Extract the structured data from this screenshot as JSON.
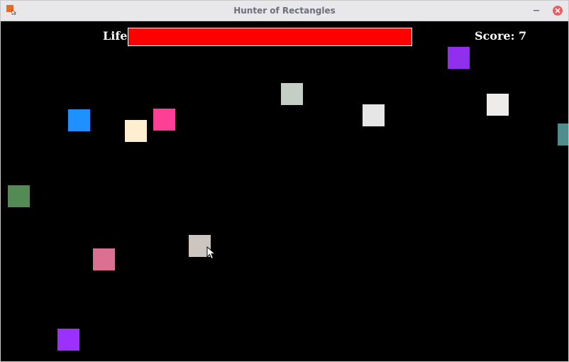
{
  "window": {
    "title": "Hunter of Rectangles",
    "app_icon": "app-icon",
    "minimize_icon": "minimize-icon",
    "close_icon": "close-icon",
    "close_color": "#f05a5a"
  },
  "hud": {
    "life_label": "Life",
    "life_level": 1.0,
    "life_color": "#ff0000",
    "score_text": "Score: 7"
  },
  "targets": [
    {
      "color": "#9030ee"
    },
    {
      "color": "#c5cec4"
    },
    {
      "color": "#e6e6e6"
    },
    {
      "color": "#eeeceb"
    },
    {
      "color": "#1e90ff"
    },
    {
      "color": "#ff3e96"
    },
    {
      "color": "#ffeecf"
    },
    {
      "color": "#4f8e8d"
    },
    {
      "color": "#548b54"
    },
    {
      "color": "#cdc5bf"
    },
    {
      "color": "#db7093"
    },
    {
      "color": "#9b30ff"
    }
  ],
  "cursor_icon": "mouse-pointer-icon"
}
